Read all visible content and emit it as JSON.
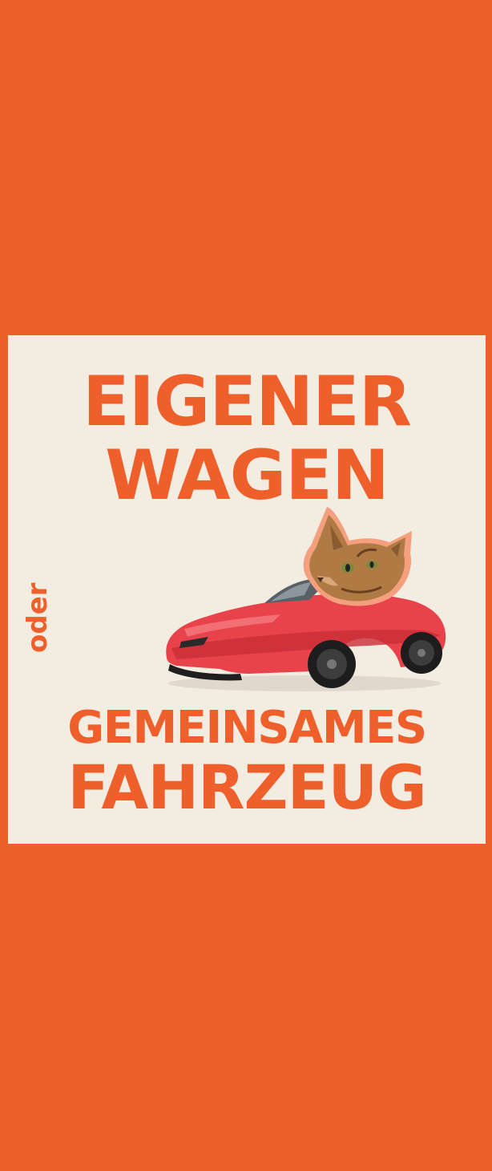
{
  "poster": {
    "line1": "EIGENER",
    "line2": "WAGEN",
    "connector": "oder",
    "line3": "GEMEINSAMES",
    "line4": "FAHRZEUG"
  },
  "colors": {
    "background": "#EF5F2C",
    "card": "#F3ECE1",
    "text": "#EF5F2C",
    "car": "#E8424A"
  },
  "illustration": {
    "car": "red-sports-car",
    "cat": "cat-head"
  }
}
